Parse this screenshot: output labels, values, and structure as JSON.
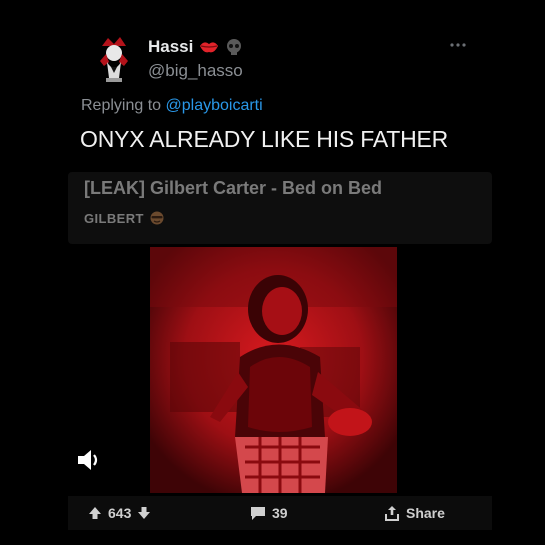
{
  "tweet": {
    "display_name": "Hassi",
    "handle": "@big_hasso",
    "replying_prefix": "Replying to ",
    "replying_to": "@playboicarti",
    "text": "ONYX ALREADY LIKE HIS FATHER",
    "badges": [
      "lips-icon",
      "skull-icon"
    ]
  },
  "card": {
    "title": "[LEAK] Gilbert Carter - Bed on Bed",
    "subtitle": "GILBERT",
    "subtitle_icon": "face-icon"
  },
  "media": {
    "type": "video",
    "tint": "#c0141a",
    "audio_icon": "speaker-icon"
  },
  "actions": {
    "upvotes": "643",
    "comments": "39",
    "share_label": "Share"
  },
  "colors": {
    "background": "#000000",
    "mention": "#2a98e8",
    "muted": "#8b8f94",
    "card": "#0e0e0e"
  }
}
